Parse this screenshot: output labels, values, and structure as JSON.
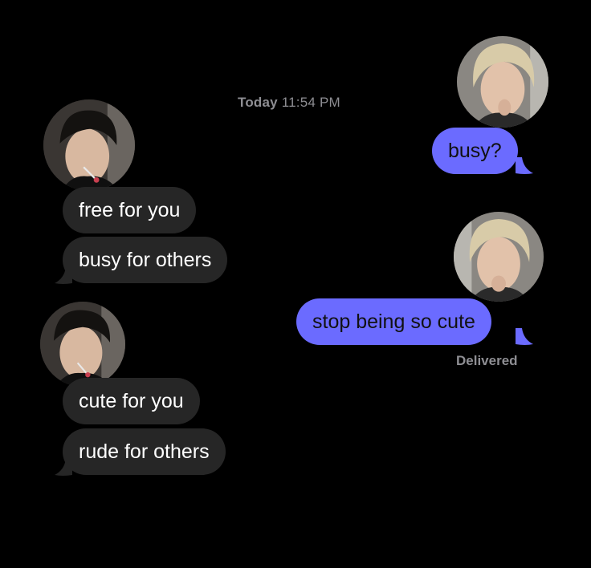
{
  "conversation": {
    "timestamp_day": "Today",
    "timestamp_time": "11:54 PM",
    "delivered_label": "Delivered",
    "colors": {
      "background": "#000000",
      "incoming_bubble": "#262626",
      "outgoing_bubble": "#6b6bff",
      "meta_text": "#8e8e93"
    },
    "messages": [
      {
        "sender": "them",
        "text": "free for you"
      },
      {
        "sender": "them",
        "text": "busy for others"
      },
      {
        "sender": "them",
        "text": "cute for you"
      },
      {
        "sender": "them",
        "text": "rude for others"
      },
      {
        "sender": "me",
        "text": "busy?"
      },
      {
        "sender": "me",
        "text": "stop being so cute"
      }
    ],
    "avatars": [
      {
        "sender": "them",
        "icon": "dark-haired-person-photo"
      },
      {
        "sender": "them",
        "icon": "dark-haired-person-photo"
      },
      {
        "sender": "me",
        "icon": "blonde-haired-person-photo"
      },
      {
        "sender": "me",
        "icon": "blonde-haired-person-photo"
      }
    ]
  }
}
